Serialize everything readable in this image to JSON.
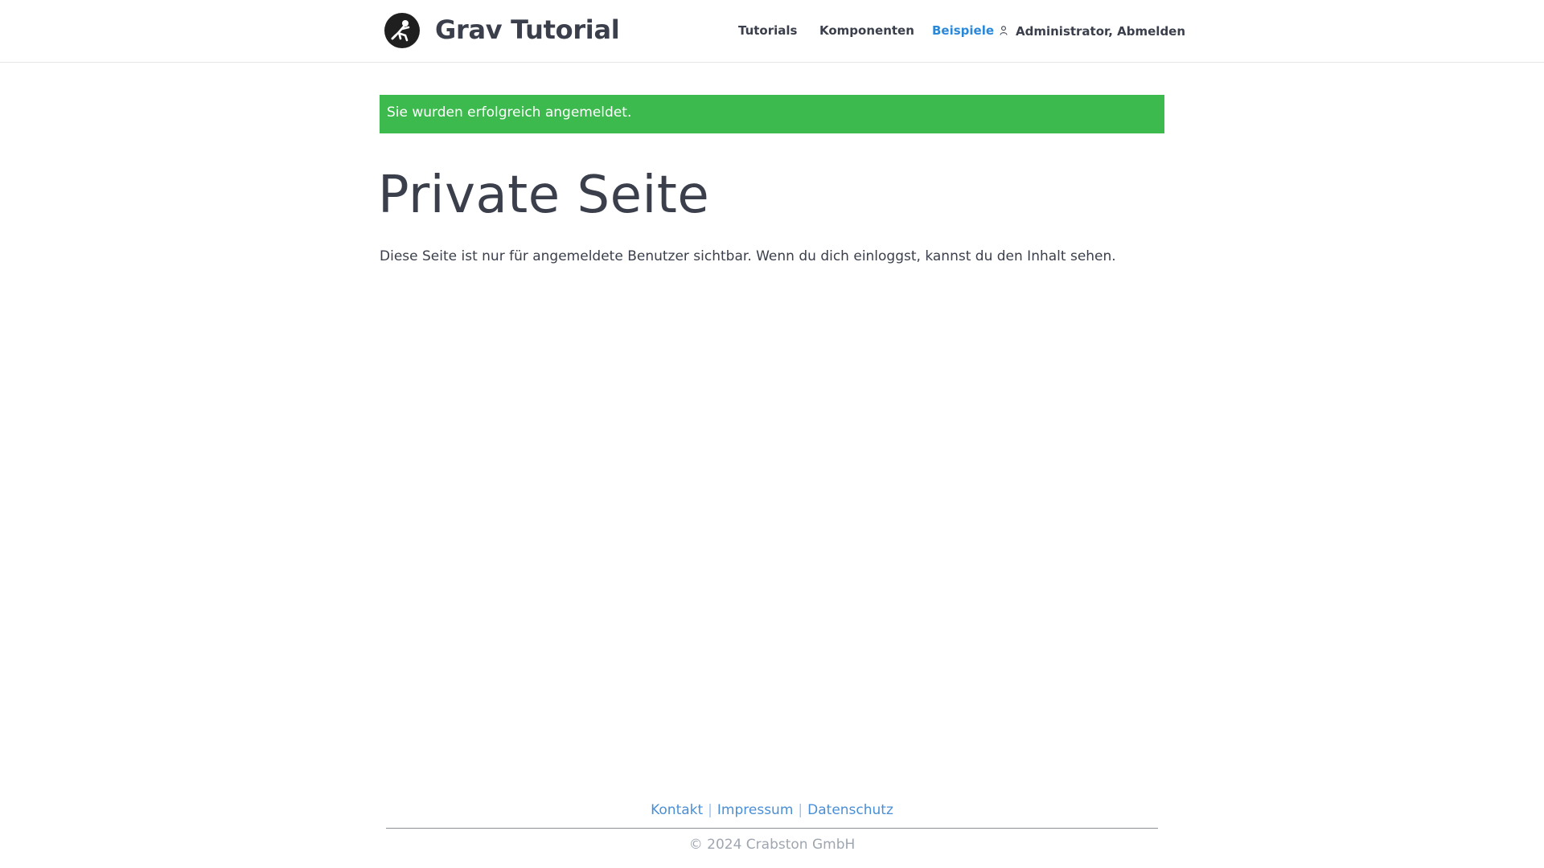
{
  "header": {
    "site_title": "Grav Tutorial",
    "logo_icon": "astronaut-logo-icon",
    "nav": [
      {
        "label": "Tutorials",
        "active": false
      },
      {
        "label": "Komponenten",
        "active": false
      },
      {
        "label": "Beispiele",
        "active": true
      }
    ],
    "user_icon": "user-icon",
    "user_name": "Administrator",
    "user_separator": ", ",
    "logout_label": "Abmelden"
  },
  "alert": {
    "message": "Sie wurden erfolgreich angemeldet.",
    "color": "#3dba4e"
  },
  "main": {
    "title": "Private Seite",
    "body": "Diese Seite ist nur für angemeldete Benutzer sichtbar. Wenn du dich einloggst, kannst du den Inhalt sehen."
  },
  "footer": {
    "links": [
      "Kontakt",
      "Impressum",
      "Datenschutz"
    ],
    "separator": "|",
    "copyright": "© 2024 Crabston GmbH"
  },
  "colors": {
    "accent": "#2b88d9",
    "text": "#3a3f4b",
    "success": "#3dba4e"
  }
}
